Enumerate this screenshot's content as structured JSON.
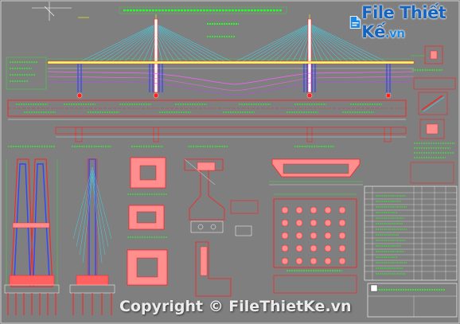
{
  "logo": {
    "text": "File",
    "text2": "Thiết Kế",
    "suffix": ".vn"
  },
  "watermark": {
    "text": "Copyright © FileThietKe.vn"
  },
  "colors": {
    "background": "#7f7f7f",
    "outline": "#ff2020",
    "cable": "#36e3ff",
    "concrete_fill": "#ff8f8f",
    "dimension": "#25ff25",
    "label": "#ffff00",
    "hatch": "#ff7070"
  }
}
